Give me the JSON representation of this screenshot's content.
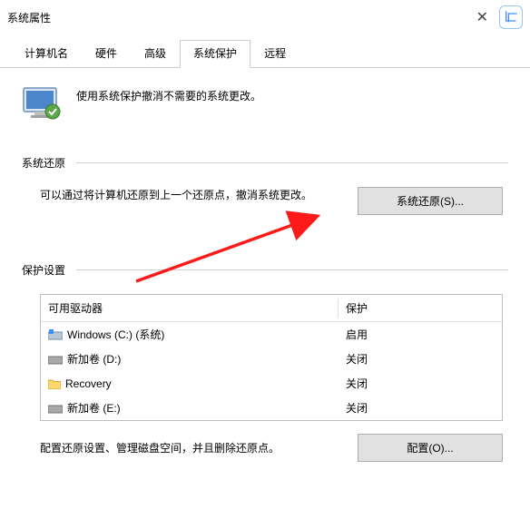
{
  "window_title": "系统属性",
  "tabs": {
    "items": [
      {
        "label": "计算机名"
      },
      {
        "label": "硬件"
      },
      {
        "label": "高级"
      },
      {
        "label": "系统保护"
      },
      {
        "label": "远程"
      }
    ],
    "active_index": 3
  },
  "intro_text": "使用系统保护撤消不需要的系统更改。",
  "sections": {
    "restore": {
      "title": "系统还原",
      "desc": "可以通过将计算机还原到上一个还原点，撤消系统更改。",
      "button": "系统还原(S)..."
    },
    "protection": {
      "title": "保护设置",
      "columns": {
        "drive": "可用驱动器",
        "status": "保护"
      },
      "drives": [
        {
          "icon": "windows-disk",
          "name": "Windows (C:) (系统)",
          "status": "启用"
        },
        {
          "icon": "disk",
          "name": "新加卷 (D:)",
          "status": "关闭"
        },
        {
          "icon": "folder",
          "name": "Recovery",
          "status": "关闭"
        },
        {
          "icon": "disk",
          "name": "新加卷 (E:)",
          "status": "关闭"
        }
      ],
      "config_desc": "配置还原设置、管理磁盘空间，并且删除还原点。",
      "config_button": "配置(O)..."
    }
  }
}
